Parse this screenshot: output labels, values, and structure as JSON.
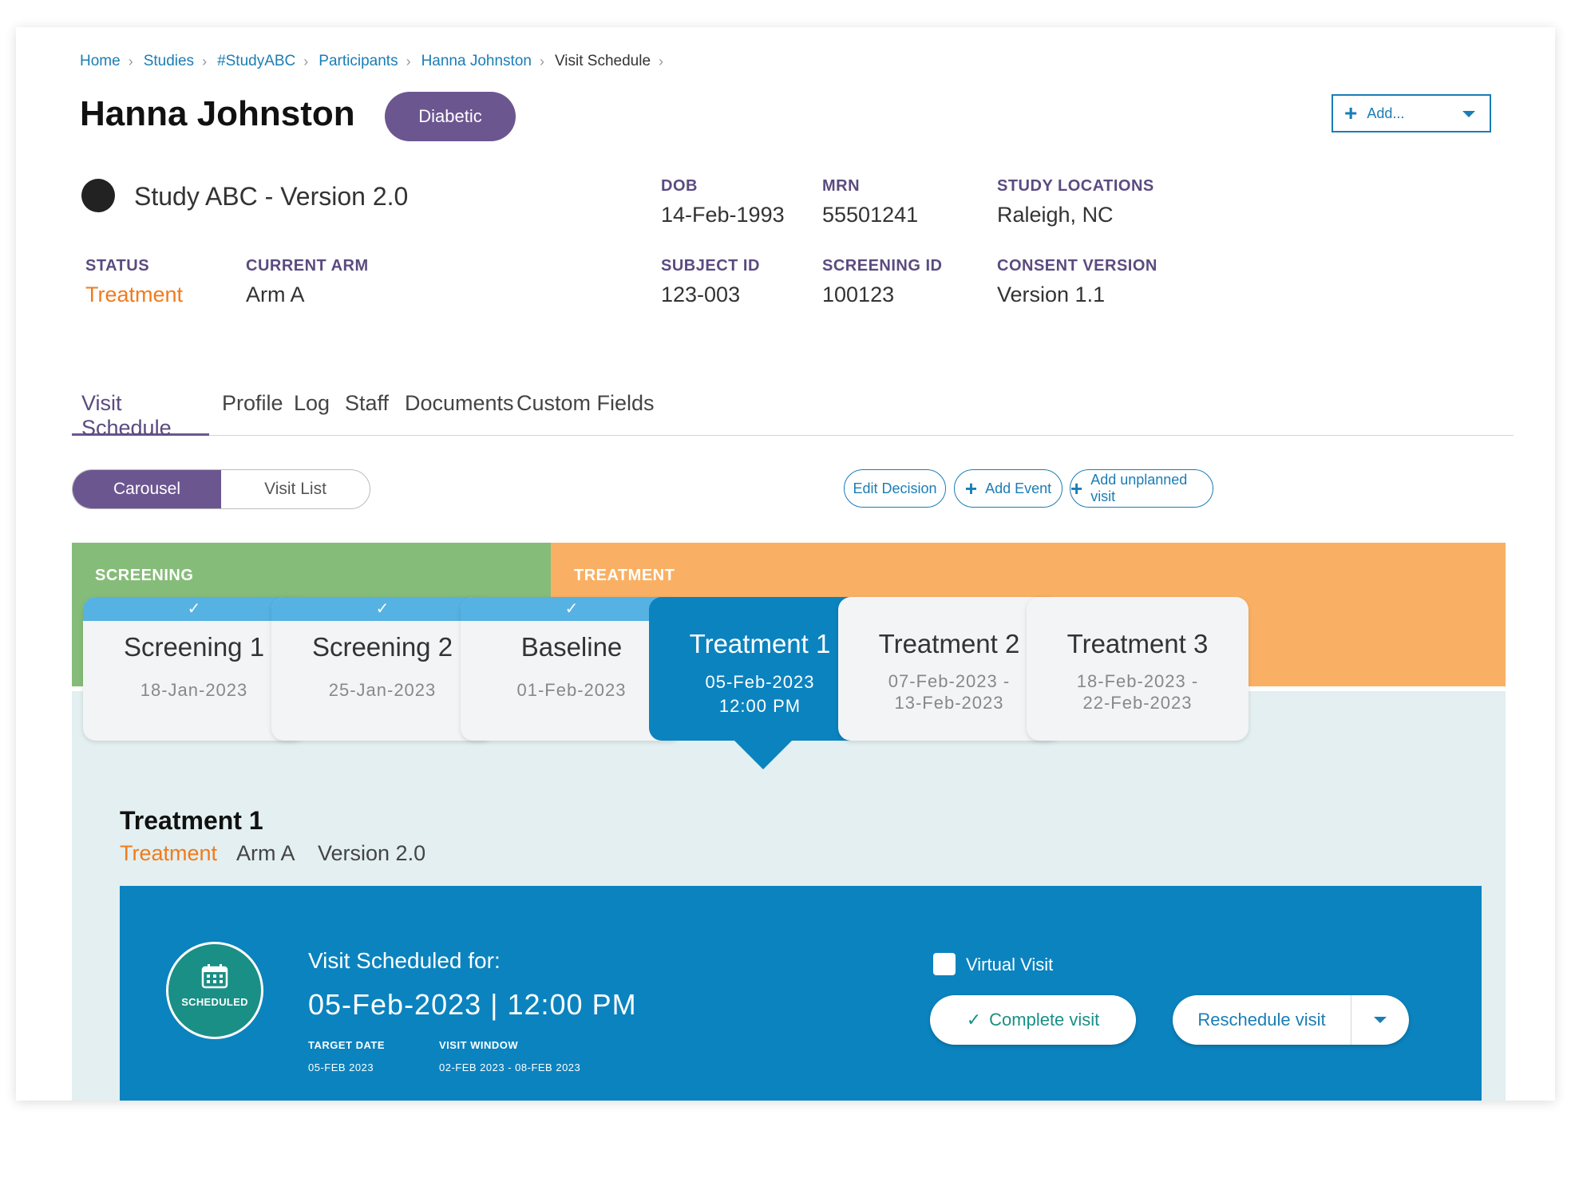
{
  "breadcrumb": [
    "Home",
    "Studies",
    "#StudyABC",
    "Participants",
    "Hanna Johnston",
    "Visit Schedule"
  ],
  "header": {
    "title": "Hanna Johnston",
    "tag": "Diabetic",
    "add_label": "Add..."
  },
  "study": {
    "name": "Study ABC - Version 2.0"
  },
  "info": {
    "dob_label": "DOB",
    "dob": "14-Feb-1993",
    "mrn_label": "MRN",
    "mrn": "55501241",
    "locations_label": "STUDY LOCATIONS",
    "locations": "Raleigh, NC",
    "status_label": "STATUS",
    "status": "Treatment",
    "arm_label": "CURRENT ARM",
    "arm": "Arm A",
    "subject_label": "SUBJECT ID",
    "subject": "123-003",
    "screening_label": "SCREENING ID",
    "screening": "100123",
    "consent_label": "CONSENT VERSION",
    "consent": "Version 1.1"
  },
  "tabs": [
    {
      "label": "Visit Schedule",
      "active": true
    },
    {
      "label": "Profile"
    },
    {
      "label": "Log"
    },
    {
      "label": "Staff"
    },
    {
      "label": "Documents"
    },
    {
      "label": "Custom Fields"
    }
  ],
  "view_toggle": {
    "carousel": "Carousel",
    "list": "Visit List"
  },
  "actions": {
    "edit_decision": "Edit Decision",
    "add_event": "Add Event",
    "add_unplanned": "Add unplanned visit"
  },
  "phases": {
    "screening": "SCREENING",
    "treatment": "TREATMENT"
  },
  "visits": [
    {
      "name": "Screening 1",
      "date": "18-Jan-2023",
      "completed": true
    },
    {
      "name": "Screening 2",
      "date": "25-Jan-2023",
      "completed": true
    },
    {
      "name": "Baseline",
      "date": "01-Feb-2023",
      "completed": true
    },
    {
      "name": "Treatment 1",
      "date": "05-Feb-2023",
      "time": "12:00 PM",
      "active": true
    },
    {
      "name": "Treatment 2",
      "date_start": "07-Feb-2023 -",
      "date_end": "13-Feb-2023"
    },
    {
      "name": "Treatment 3",
      "date_start": "18-Feb-2023 -",
      "date_end": "22-Feb-2023"
    }
  ],
  "detail": {
    "title": "Treatment 1",
    "phase": "Treatment",
    "arm": "Arm A",
    "version": "Version 2.0",
    "status_badge": "SCHEDULED",
    "heading": "Visit Scheduled for:",
    "datetime": "05-Feb-2023 | 12:00 PM",
    "target_label": "TARGET DATE",
    "target_value": "05-FEB 2023",
    "window_label": "VISIT WINDOW",
    "window_value": "02-FEB 2023 - 08-FEB 2023",
    "virtual_label": "Virtual Visit",
    "virtual_checked": false,
    "complete_label": "Complete visit",
    "reschedule_label": "Reschedule visit"
  },
  "colors": {
    "primary": "#0b83bf",
    "purple": "#6c5690",
    "screening_band": "#86bc79",
    "treatment_band": "#f9b064",
    "status_orange": "#f07b1d",
    "scheduled_teal": "#1a8f86"
  }
}
